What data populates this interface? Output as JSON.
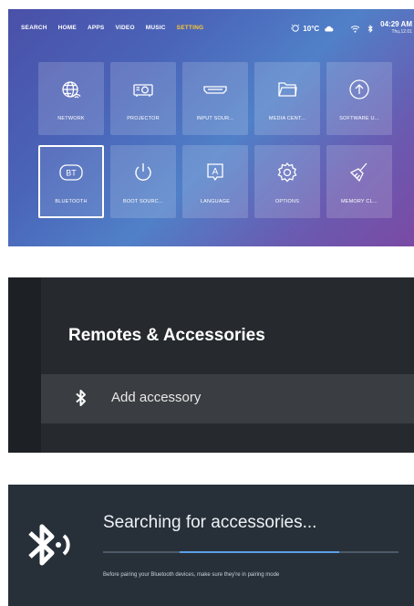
{
  "launcher": {
    "nav": [
      {
        "label": "SEARCH",
        "active": false
      },
      {
        "label": "HOME",
        "active": false
      },
      {
        "label": "APPS",
        "active": false
      },
      {
        "label": "VIDEO",
        "active": false
      },
      {
        "label": "MUSIC",
        "active": false
      },
      {
        "label": "SETTING",
        "active": true
      }
    ],
    "status": {
      "temperature": "10°C",
      "time": "04:29 AM",
      "date": "Thu,12.01"
    },
    "tiles": [
      {
        "label": "NETWORK",
        "icon": "globe-wifi-icon",
        "selected": false
      },
      {
        "label": "PROJECTOR",
        "icon": "projector-icon",
        "selected": false
      },
      {
        "label": "INPUT SOUR...",
        "icon": "hdmi-icon",
        "selected": false
      },
      {
        "label": "MEDIA CENT...",
        "icon": "folder-icon",
        "selected": false
      },
      {
        "label": "SOFTWARE U...",
        "icon": "upload-icon",
        "selected": false
      },
      {
        "label": "BLUETOOTH",
        "icon": "bt-icon",
        "selected": true
      },
      {
        "label": "BOOT SOURC...",
        "icon": "power-icon",
        "selected": false
      },
      {
        "label": "LANGUAGE",
        "icon": "language-icon",
        "selected": false
      },
      {
        "label": "OPTIONS",
        "icon": "gear-icon",
        "selected": false
      },
      {
        "label": "MEMORY CL...",
        "icon": "broom-icon",
        "selected": false
      }
    ],
    "colors": {
      "active_nav": "#ffc730"
    }
  },
  "remotes": {
    "title": "Remotes & Accessories",
    "items": [
      {
        "label": "Add accessory",
        "icon": "bluetooth-icon"
      }
    ]
  },
  "searching": {
    "title": "Searching for accessories...",
    "hint": "Before pairing your Bluetooth devices, make sure they're in pairing mode",
    "progress": {
      "start": 0.26,
      "end": 0.8
    },
    "colors": {
      "progress": "#5ba0e8"
    }
  }
}
